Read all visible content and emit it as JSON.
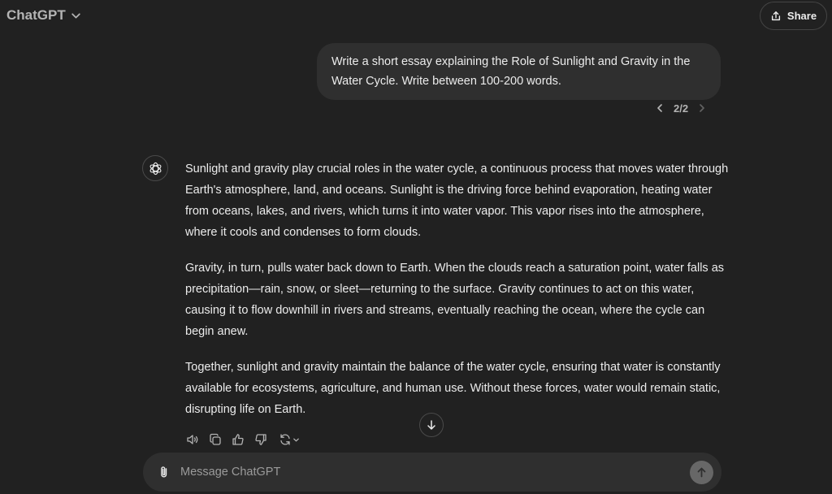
{
  "header": {
    "model_label": "ChatGPT",
    "share_label": "Share"
  },
  "user_message": {
    "text": "Write a short essay explaining the Role of Sunlight and Gravity in the Water Cycle. Write between 100-200 words.",
    "pager": "2/2"
  },
  "assistant": {
    "paragraphs": [
      "Sunlight and gravity play crucial roles in the water cycle, a continuous process that moves water through Earth's atmosphere, land, and oceans. Sunlight is the driving force behind evaporation, heating water from oceans, lakes, and rivers, which turns it into water vapor. This vapor rises into the atmosphere, where it cools and condenses to form clouds.",
      "Gravity, in turn, pulls water back down to Earth. When the clouds reach a saturation point, water falls as precipitation—rain, snow, or sleet—returning to the surface. Gravity continues to act on this water, causing it to flow downhill in rivers and streams, eventually reaching the ocean, where the cycle can begin anew.",
      "Together, sunlight and gravity maintain the balance of the water cycle, ensuring that water is constantly available for ecosystems, agriculture, and human use. Without these forces, water would remain static, disrupting life on Earth."
    ],
    "action_icons": [
      "read-aloud-icon",
      "copy-icon",
      "thumbs-up-icon",
      "thumbs-down-icon",
      "regenerate-icon"
    ]
  },
  "composer": {
    "placeholder": "Message ChatGPT"
  },
  "colors": {
    "background": "#212121",
    "bubble": "#2f2f2f",
    "text": "#ececec",
    "muted": "#b4b4b4",
    "send_disabled": "#676767"
  }
}
